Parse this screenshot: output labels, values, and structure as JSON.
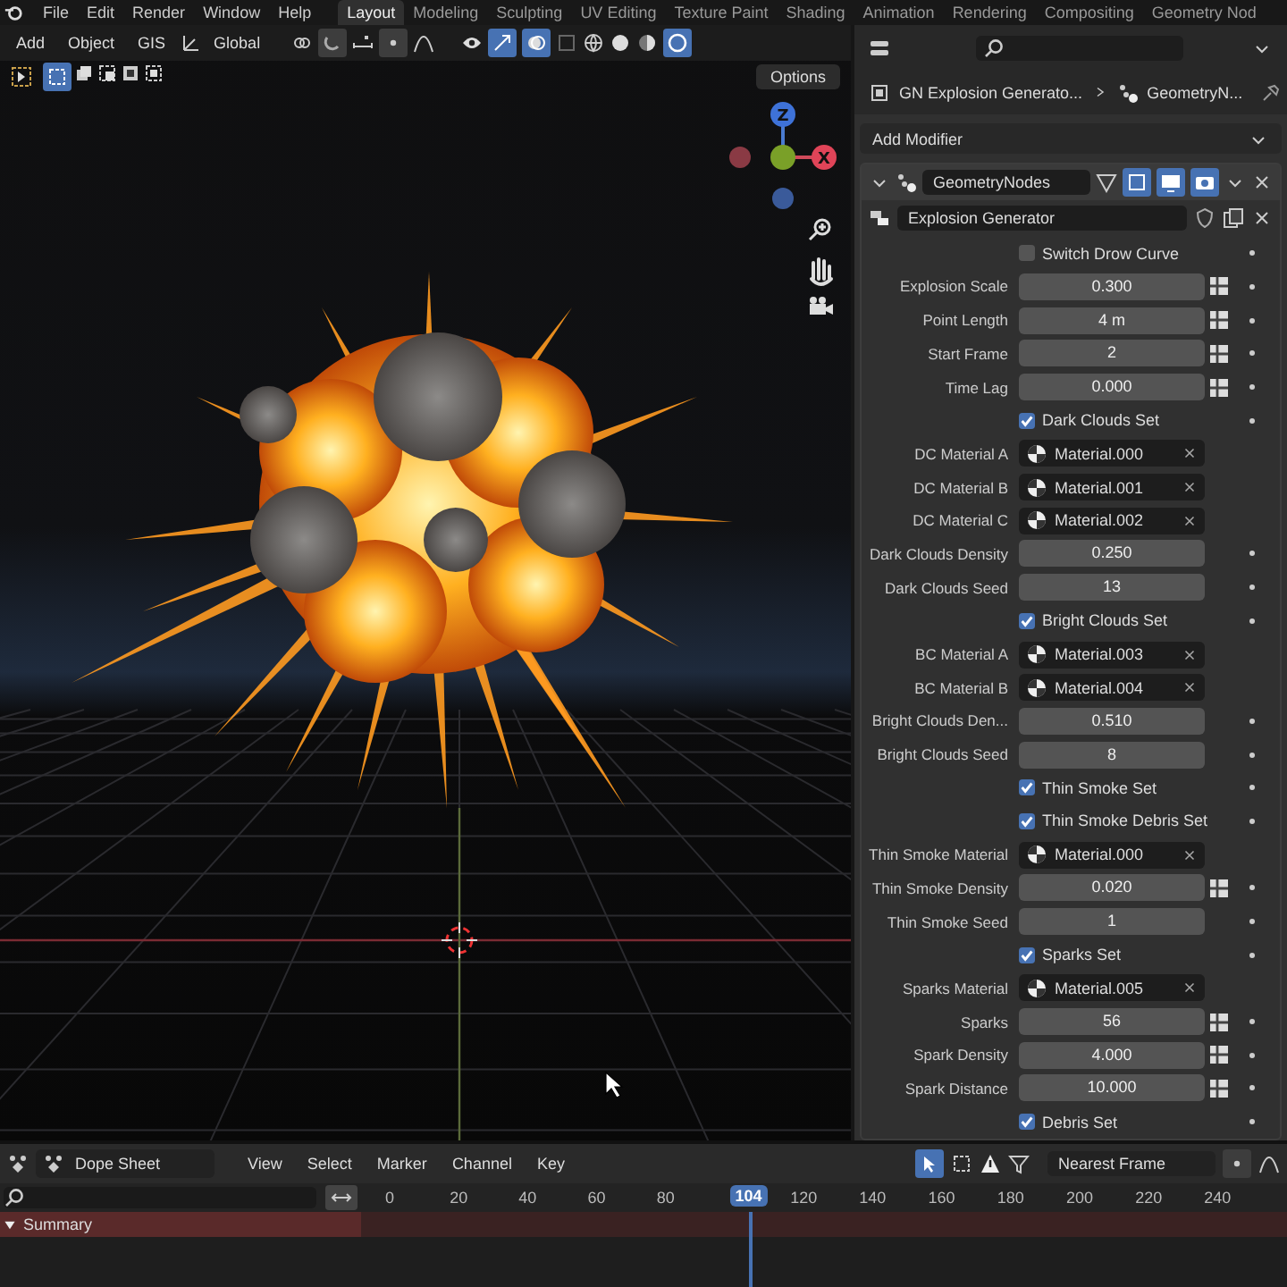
{
  "top_bar": {
    "menus": [
      "File",
      "Edit",
      "Render",
      "Window",
      "Help"
    ],
    "workspaces": [
      {
        "label": "Layout",
        "selected": true
      },
      {
        "label": "Modeling",
        "selected": false
      },
      {
        "label": "Sculpting",
        "selected": false
      },
      {
        "label": "UV Editing",
        "selected": false
      },
      {
        "label": "Texture Paint",
        "selected": false
      },
      {
        "label": "Shading",
        "selected": false
      },
      {
        "label": "Animation",
        "selected": false
      },
      {
        "label": "Rendering",
        "selected": false
      },
      {
        "label": "Compositing",
        "selected": false
      },
      {
        "label": "Geometry Nod",
        "selected": false
      }
    ]
  },
  "viewport": {
    "menus": [
      "Add",
      "Object",
      "GIS"
    ],
    "orientation": "Global",
    "options": "Options",
    "gizmo_x": "X",
    "gizmo_z": "Z"
  },
  "properties": {
    "breadcrumbs": [
      "GN Explosion Generato...",
      "GeometryN..."
    ],
    "add_modifier": "Add Modifier",
    "modifier_name": "GeometryNodes",
    "node_group": "Explosion Generator",
    "inputs": [
      {
        "kind": "checkbox",
        "label": "Switch Drow Curve",
        "checked": false
      },
      {
        "kind": "number",
        "label": "Explosion Scale",
        "value": "0.300",
        "attribute_toggle": true
      },
      {
        "kind": "number",
        "label": "Point Length",
        "value": "4 m",
        "attribute_toggle": true
      },
      {
        "kind": "number",
        "label": "Start Frame",
        "value": "2",
        "attribute_toggle": true
      },
      {
        "kind": "number",
        "label": "Time Lag",
        "value": "0.000",
        "attribute_toggle": true
      },
      {
        "kind": "checkbox",
        "label": "Dark Clouds Set",
        "checked": true
      },
      {
        "kind": "material",
        "label": "DC Material A",
        "value": "Material.000"
      },
      {
        "kind": "material",
        "label": "DC Material B",
        "value": "Material.001"
      },
      {
        "kind": "material",
        "label": "DC Material C",
        "value": "Material.002"
      },
      {
        "kind": "number",
        "label": "Dark Clouds Density",
        "value": "0.250",
        "attribute_toggle": false
      },
      {
        "kind": "number",
        "label": "Dark Clouds Seed",
        "value": "13",
        "attribute_toggle": false
      },
      {
        "kind": "checkbox",
        "label": "Bright Clouds Set",
        "checked": true
      },
      {
        "kind": "material",
        "label": "BC Material A",
        "value": "Material.003"
      },
      {
        "kind": "material",
        "label": "BC Material B",
        "value": "Material.004"
      },
      {
        "kind": "number",
        "label": "Bright Clouds Den...",
        "value": "0.510",
        "attribute_toggle": false
      },
      {
        "kind": "number",
        "label": "Bright Clouds Seed",
        "value": "8",
        "attribute_toggle": false
      },
      {
        "kind": "checkbox",
        "label": "Thin Smoke Set",
        "checked": true
      },
      {
        "kind": "checkbox",
        "label": "Thin Smoke Debris Set",
        "checked": true
      },
      {
        "kind": "material",
        "label": "Thin Smoke Material",
        "value": "Material.000"
      },
      {
        "kind": "number",
        "label": "Thin Smoke Density",
        "value": "0.020",
        "attribute_toggle": true
      },
      {
        "kind": "number",
        "label": "Thin Smoke Seed",
        "value": "1",
        "attribute_toggle": false
      },
      {
        "kind": "checkbox",
        "label": "Sparks Set",
        "checked": true
      },
      {
        "kind": "material",
        "label": "Sparks Material",
        "value": "Material.005"
      },
      {
        "kind": "number",
        "label": "Sparks",
        "value": "56",
        "attribute_toggle": true
      },
      {
        "kind": "number",
        "label": "Spark Density",
        "value": "4.000",
        "attribute_toggle": true
      },
      {
        "kind": "number",
        "label": "Spark Distance",
        "value": "10.000",
        "attribute_toggle": true
      },
      {
        "kind": "checkbox",
        "label": "Debris Set",
        "checked": true
      }
    ]
  },
  "timeline": {
    "editor": "Dope Sheet",
    "menus": [
      "View",
      "Select",
      "Marker",
      "Channel",
      "Key"
    ],
    "snapping": "Nearest Frame",
    "frame_labels": [
      "0",
      "20",
      "40",
      "60",
      "80",
      "120",
      "140",
      "160",
      "180",
      "200",
      "220",
      "240"
    ],
    "current_frame": "104",
    "channels": [
      {
        "name": "Summary",
        "expanded": true
      }
    ]
  }
}
